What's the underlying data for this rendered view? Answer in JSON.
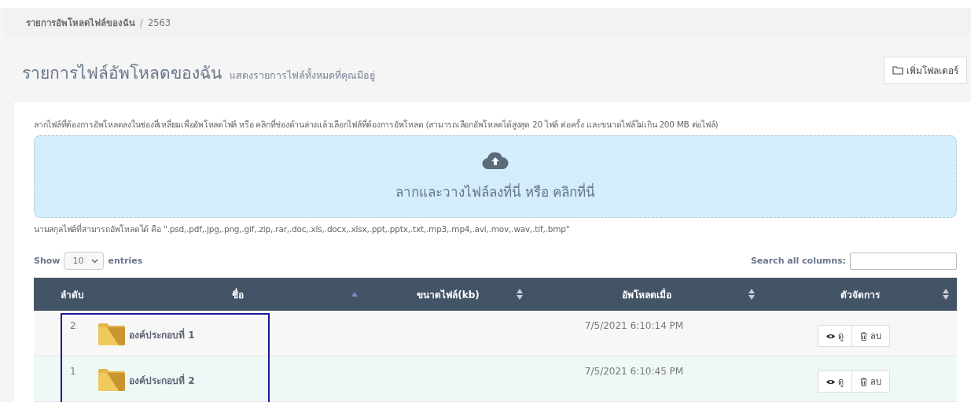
{
  "breadcrumb_separator": "/",
  "breadcrumb": [
    {
      "label": "รายการอัพโหลดไฟล์ของฉัน",
      "selected": false
    },
    {
      "label": "2563",
      "selected": true
    }
  ],
  "page_title": "รายการไฟล์อัพโหลดของฉัน",
  "page_subtitle": "แสดงรายการไฟล์ทั้งหมดที่คุณมีอยู่",
  "add_folder_button": "เพิ่มโฟลเดอร์",
  "instructions": "ลากไฟล์ที่ต้องการอัพโหลดลงในช่องสี่เหลี่ยมเพื่ออัพโหลดไฟล์ หรือ คลิกที่ช่องด้านล่างแล้วเลือกไฟล์ที่ต้องการอัพโหลด (สามารถเลือกอัพโหลดได้สูงสุด 20 ไฟล์ ต่อครั้ง และขนาดไฟล์ไม่เกิน 200 MB ต่อไฟล์)",
  "dropzone": {
    "label": "ลากและวางไฟล์ลงที่นี่ หรือ คลิกที่นี่"
  },
  "allowed_types": "นามสกุลไฟล์ที่สามารถอัพโหลดได้ คือ \".psd,.pdf,.jpg,.png,.gif,.zip,.rar,.doc,.xls,.docx,.xlsx,.ppt,.pptx,.txt,.mp3,.mp4,.avi,.mov,.wav,.tif,.bmp\"",
  "length_control": {
    "show_label": "Show",
    "value": "10",
    "entries_label": "entries"
  },
  "search": {
    "label": "Search all columns:"
  },
  "table": {
    "outlined": true,
    "columns": [
      {
        "label": "ลำดับ",
        "sortable": false,
        "sorted": false
      },
      {
        "label": "ชื่อ",
        "sortable": true,
        "sorted": true
      },
      {
        "label": "ขนาดไฟล์(kb)",
        "sortable": true,
        "sorted": false
      },
      {
        "label": "อัพโหลดเมื่อ",
        "sortable": true,
        "sorted": false
      },
      {
        "label": "ตัวจัดการ",
        "sortable": true,
        "sorted": false
      }
    ],
    "rows": [
      {
        "index": "2",
        "name": "องค์ประกอบที่ 1",
        "uploaded": "7/5/2021 6:10:14 PM",
        "view": "ดู",
        "delete": "ลบ"
      },
      {
        "index": "1",
        "name": "องค์ประกอบที่ 2",
        "uploaded": "7/5/2021 6:10:45 PM",
        "view": "ดู",
        "delete": "ลบ"
      }
    ]
  }
}
